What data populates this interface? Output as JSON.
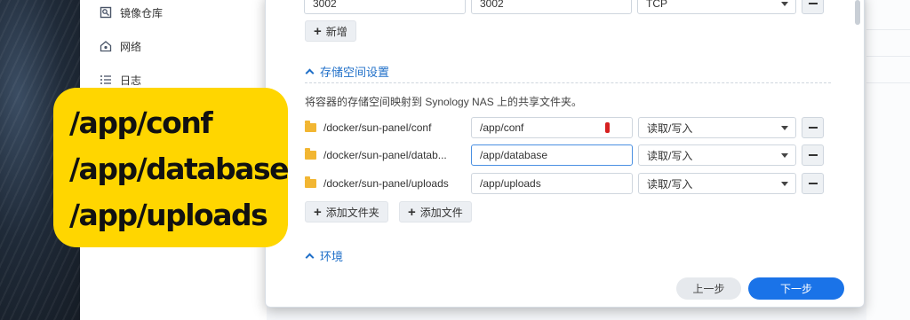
{
  "sidebar": {
    "items": [
      {
        "label": "镜像仓库",
        "icon": "image-registry-icon"
      },
      {
        "label": "网络",
        "icon": "network-icon"
      },
      {
        "label": "日志",
        "icon": "log-list-icon"
      }
    ]
  },
  "port_row": {
    "local_port": "3002",
    "container_port": "3002",
    "protocol": "TCP"
  },
  "add_port_label": "新增",
  "storage": {
    "section_title": "存储空间设置",
    "description": "将容器的存储空间映射到 Synology NAS 上的共享文件夹。",
    "rows": [
      {
        "folder": "/docker/sun-panel/conf",
        "mount": "/app/conf",
        "mode": "读取/写入"
      },
      {
        "folder": "/docker/sun-panel/datab...",
        "mount": "/app/database",
        "mode": "读取/写入"
      },
      {
        "folder": "/docker/sun-panel/uploads",
        "mount": "/app/uploads",
        "mode": "读取/写入"
      }
    ],
    "add_folder_label": "添加文件夹",
    "add_file_label": "添加文件"
  },
  "env_section_title": "环境",
  "footer": {
    "prev_label": "上一步",
    "next_label": "下一步"
  },
  "callout": {
    "lines": [
      "/app/conf",
      "/app/database",
      "/app/uploads"
    ]
  },
  "colors": {
    "accent": "#1a73e8",
    "section_link": "#1f6fc8",
    "callout_bg": "#ffd600",
    "folder": "#f2b632"
  }
}
